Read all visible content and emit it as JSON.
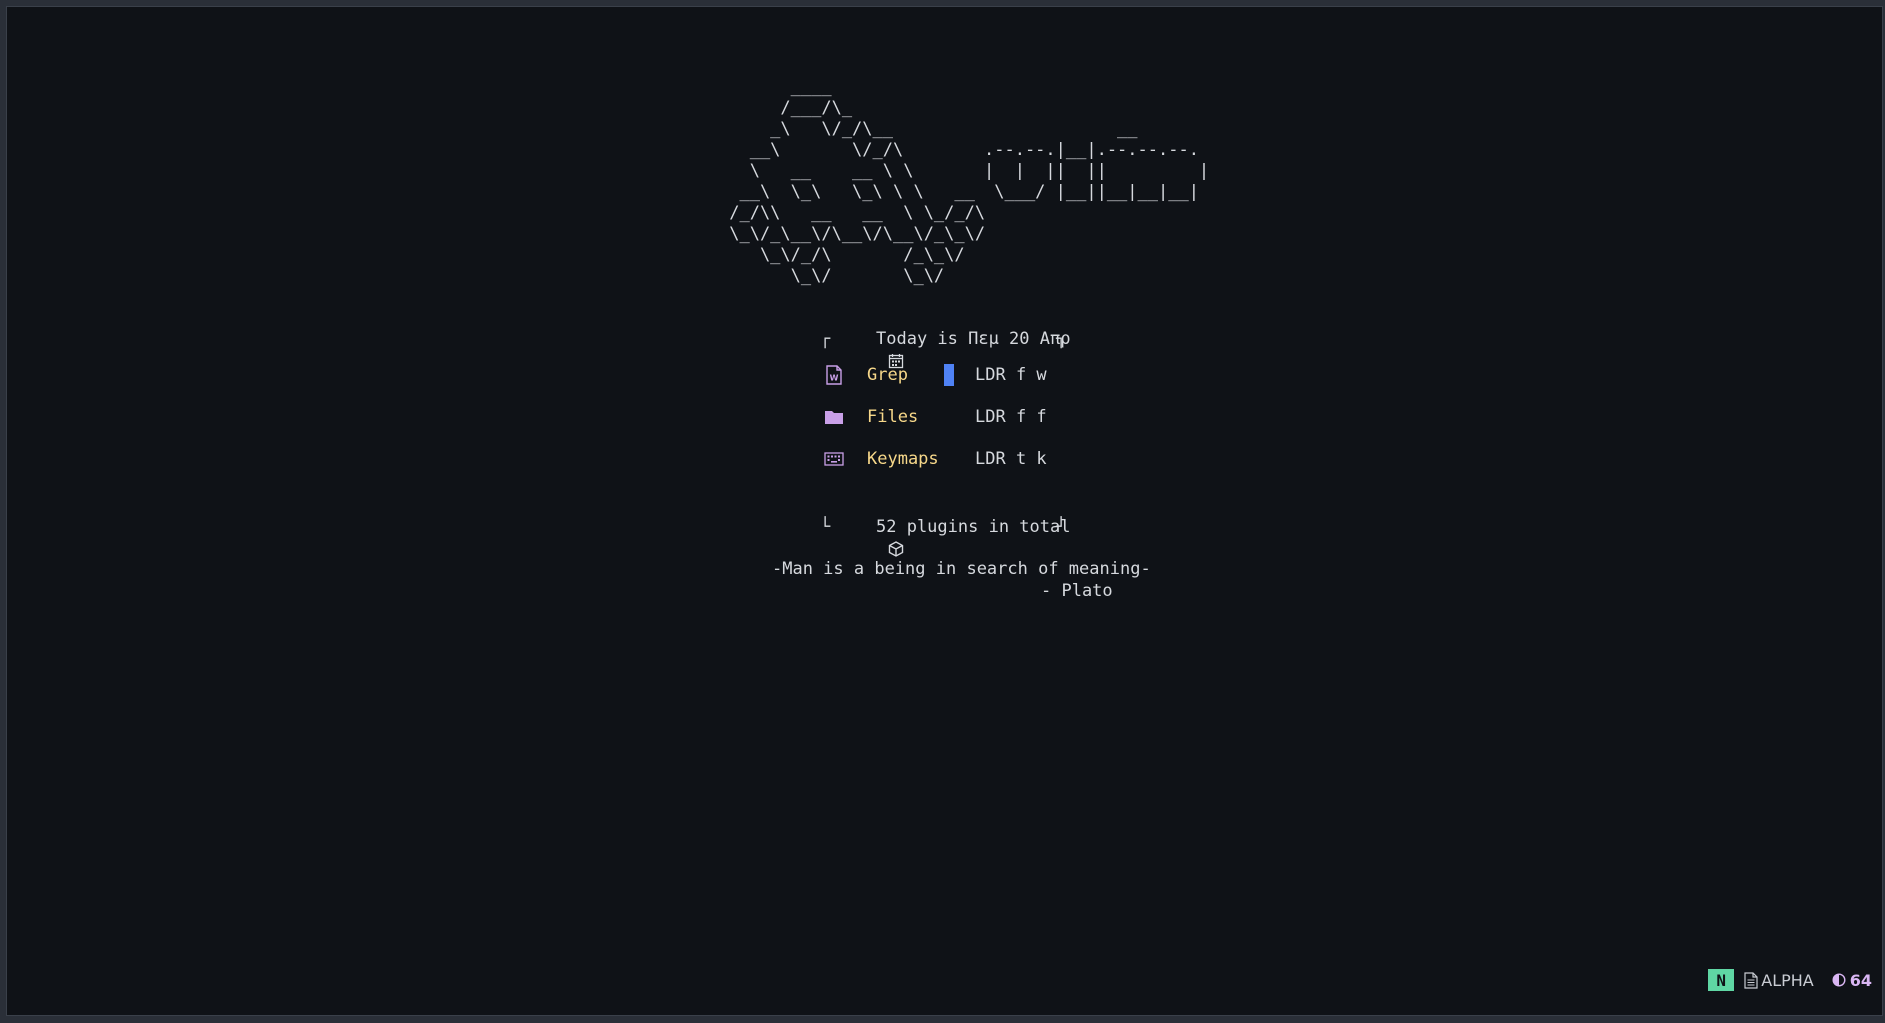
{
  "dashboard": {
    "logo_ascii": "       ____\n      /___/\\_\n     _\\   \\/_/\\__\n   __\\       \\/_/\\\n   \\   __    __ \\ \\\n  __\\  \\_\\   \\_\\ \\ \\   __\n /_/\\\\   __   __  \\ \\_/_/\\\n \\_\\/_\\__\\/\\__\\/\\__\\/_\\_\\/\n    \\_\\/_/\\       /_\\_\\/\n       \\_\\/       \\_\\/",
    "logo_text_ascii": "             __\n.--.--.|__|.--.--.--.\n|  |  ||  ||         |\n \\___/ |__||__|__|__|",
    "header_left_corner": "┌",
    "header_right_corner": "┐",
    "header_text": "Today is Πεμ 20 Απρ",
    "menu_items": [
      {
        "label": "Grep",
        "keys": "LDR f w",
        "icon": "file-word-icon"
      },
      {
        "label": "Files",
        "keys": "LDR f f",
        "icon": "folder-icon"
      },
      {
        "label": "Keymaps",
        "keys": "LDR t k",
        "icon": "keyboard-icon"
      }
    ],
    "footer_left_corner": "└",
    "footer_right_corner": "┘",
    "footer_text": "52 plugins in total",
    "quote_line": "-Man is a being in search of meaning-",
    "quote_author": "- Plato"
  },
  "statusline": {
    "mode": "N",
    "filetype": "ALPHA",
    "percent": "64"
  },
  "colors": {
    "background": "#0f1217",
    "menu_label": "#f7d88a",
    "icon": "#c9a0e8",
    "cursor": "#4f82f5",
    "mode_badge": "#5fd6a4",
    "percent": "#d9b6f3"
  }
}
